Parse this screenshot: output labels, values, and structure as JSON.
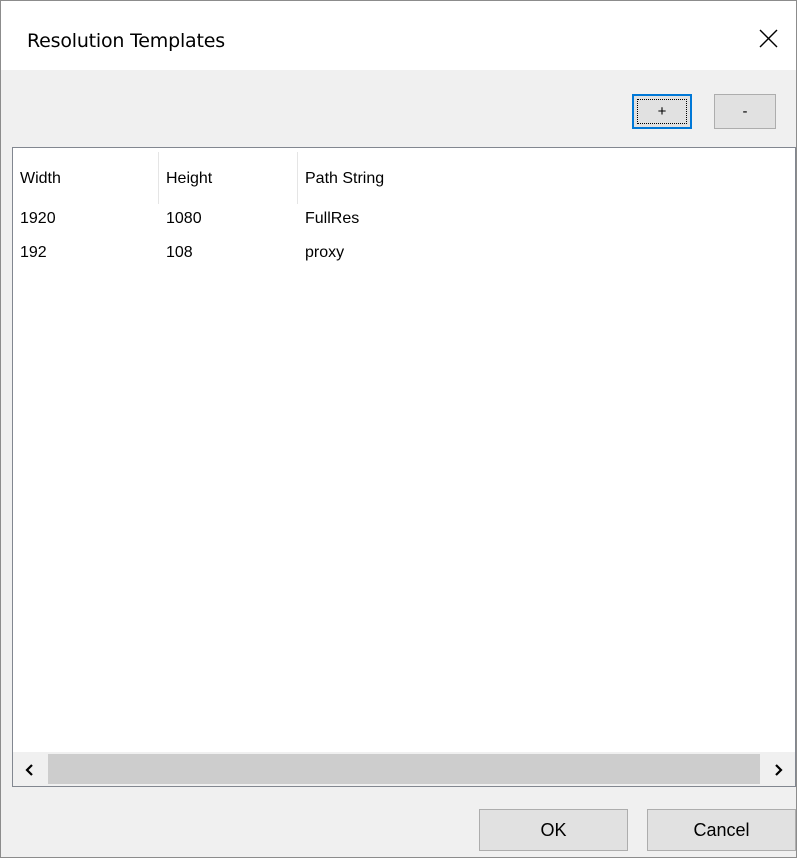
{
  "dialog": {
    "title": "Resolution Templates",
    "close_icon": "close-icon"
  },
  "toolbar": {
    "add_label": "+",
    "remove_label": "-"
  },
  "table": {
    "columns": [
      "Width",
      "Height",
      "Path String"
    ],
    "rows": [
      [
        "1920",
        "1080",
        "FullRes"
      ],
      [
        "192",
        "108",
        "proxy"
      ]
    ]
  },
  "scrollbar": {
    "left_icon": "chevron-left-icon",
    "right_icon": "chevron-right-icon"
  },
  "footer": {
    "ok_label": "OK",
    "cancel_label": "Cancel"
  },
  "colors": {
    "focus_border": "#0078d7",
    "button_face": "#e1e1e1",
    "dialog_face": "#f0f0f0"
  }
}
